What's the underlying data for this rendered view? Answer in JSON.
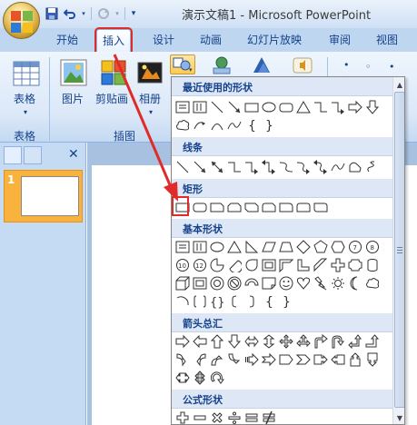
{
  "app": {
    "title": "演示文稿1 - Microsoft PowerPoint"
  },
  "tabs": [
    {
      "label": "开始"
    },
    {
      "label": "插入",
      "active": true
    },
    {
      "label": "设计"
    },
    {
      "label": "动画"
    },
    {
      "label": "幻灯片放映"
    },
    {
      "label": "审阅"
    },
    {
      "label": "视图"
    }
  ],
  "ribbon": {
    "groups": [
      {
        "label": "表格",
        "buttons": [
          {
            "label": "表格"
          }
        ]
      },
      {
        "label": "插图",
        "buttons": [
          {
            "label": "图片"
          },
          {
            "label": "剪贴画"
          },
          {
            "label": "相册"
          }
        ]
      }
    ]
  },
  "slide_panel": {
    "slides": [
      {
        "number": "1"
      }
    ]
  },
  "shapes_gallery": {
    "sections": [
      {
        "title": "最近使用的形状"
      },
      {
        "title": "线条"
      },
      {
        "title": "矩形"
      },
      {
        "title": "基本形状"
      },
      {
        "title": "箭头总汇"
      },
      {
        "title": "公式形状"
      }
    ]
  },
  "colors": {
    "accent_highlight": "#e02b2b",
    "ribbon_text": "#15428b",
    "slide_thumb_border": "#f8b23d"
  },
  "icons": {
    "office_button": "office-logo-icon",
    "qat": [
      "save-icon",
      "undo-icon",
      "redo-icon",
      "customize-qat-icon"
    ],
    "ribbon": [
      "table-icon",
      "picture-icon",
      "clipart-icon",
      "photo-album-icon",
      "shapes-icon",
      "smartart-icon",
      "chart-icon",
      "sound-icon"
    ]
  }
}
